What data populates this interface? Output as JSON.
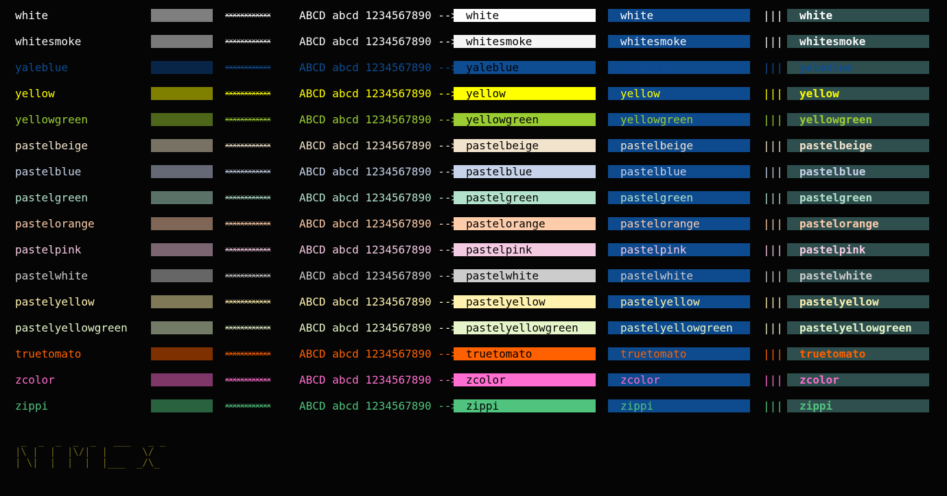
{
  "sample_text": "ABCD abcd 1234567890 -->",
  "xes_text": "xxxxxxxxxxxx",
  "pipes_text": "|||",
  "rows": [
    {
      "name": "white",
      "fg": "#ffffff",
      "dim": "#7f7f7f",
      "bg": "#ffffff",
      "blue_fg": "#ffffff",
      "teal_fg": "#ffffff"
    },
    {
      "name": "whitesmoke",
      "fg": "#f5f5f5",
      "dim": "#7a7a7a",
      "bg": "#f5f5f5",
      "blue_fg": "#f5f5f5",
      "teal_fg": "#f5f5f5"
    },
    {
      "name": "yaleblue",
      "fg": "#0f4d92",
      "dim": "#082547",
      "bg": "#0f4d92",
      "blue_fg": "#0f4d92",
      "teal_fg": "#0f4d92"
    },
    {
      "name": "yellow",
      "fg": "#ffff00",
      "dim": "#808000",
      "bg": "#ffff00",
      "blue_fg": "#ffff00",
      "teal_fg": "#ffff00"
    },
    {
      "name": "yellowgreen",
      "fg": "#9acd32",
      "dim": "#4d6619",
      "bg": "#9acd32",
      "blue_fg": "#9acd32",
      "teal_fg": "#9acd32"
    },
    {
      "name": "pastelbeige",
      "fg": "#f2e3cc",
      "dim": "#787265",
      "bg": "#f2e3cc",
      "blue_fg": "#f2e3cc",
      "teal_fg": "#f2e3cc"
    },
    {
      "name": "pastelblue",
      "fg": "#c7d3ea",
      "dim": "#646975",
      "bg": "#c7d3ea",
      "blue_fg": "#c7d3ea",
      "teal_fg": "#c7d3ea"
    },
    {
      "name": "pastelgreen",
      "fg": "#b3e2cc",
      "dim": "#597166",
      "bg": "#b3e2cc",
      "blue_fg": "#b3e2cc",
      "teal_fg": "#b3e2cc"
    },
    {
      "name": "pastelorange",
      "fg": "#fdcdab",
      "dim": "#7f6656",
      "bg": "#fdcdab",
      "blue_fg": "#fdcdab",
      "teal_fg": "#fdcdab"
    },
    {
      "name": "pastelpink",
      "fg": "#f4cae3",
      "dim": "#7a6571",
      "bg": "#f4cae3",
      "blue_fg": "#f4cae3",
      "teal_fg": "#f4cae3"
    },
    {
      "name": "pastelwhite",
      "fg": "#cccccc",
      "dim": "#666666",
      "bg": "#cccccc",
      "blue_fg": "#cccccc",
      "teal_fg": "#cccccc"
    },
    {
      "name": "pastelyellow",
      "fg": "#fff2ae",
      "dim": "#7f7957",
      "bg": "#fff2ae",
      "blue_fg": "#fff2ae",
      "teal_fg": "#fff2ae"
    },
    {
      "name": "pastelyellowgreen",
      "fg": "#e6f5c9",
      "dim": "#737a65",
      "bg": "#e6f5c9",
      "blue_fg": "#e6f5c9",
      "teal_fg": "#e6f5c9"
    },
    {
      "name": "truetomato",
      "fg": "#ff6100",
      "dim": "#7f3000",
      "bg": "#ff6100",
      "blue_fg": "#ff6100",
      "teal_fg": "#ff6100"
    },
    {
      "name": "zcolor",
      "fg": "#ff6ed0",
      "dim": "#7f3768",
      "bg": "#ff6ed0",
      "blue_fg": "#ff6ed0",
      "teal_fg": "#ff6ed0"
    },
    {
      "name": "zippi",
      "fg": "#50c47e",
      "dim": "#28623f",
      "bg": "#50c47e",
      "blue_fg": "#50c47e",
      "teal_fg": "#50c47e"
    }
  ],
  "logo": " _  _  _  _  _   ___   _ _\n|\\ |  |  |\\/|  |      \\/\n| \\|  |  |  |  |___  _/\\_"
}
